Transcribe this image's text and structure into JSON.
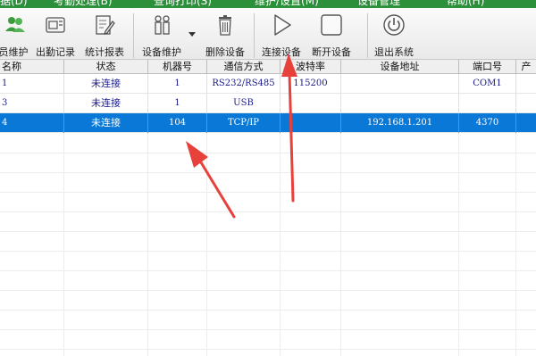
{
  "menubar": {
    "items": [
      "据(D)",
      "考勤处理(B)",
      "查询打印(S)",
      "维护/设置(M)",
      "设备管理",
      "帮助(H)"
    ]
  },
  "toolbar": {
    "buttons": [
      {
        "label": "员维护",
        "icon": "users-icon"
      },
      {
        "label": "出勤记录",
        "icon": "attendance-record-icon"
      },
      {
        "label": "统计报表",
        "icon": "report-edit-icon"
      },
      {
        "label": "设备维护",
        "icon": "device-maintenance-icon"
      },
      {
        "label": "删除设备",
        "icon": "trash-icon"
      },
      {
        "label": "连接设备",
        "icon": "play-icon"
      },
      {
        "label": "断开设备",
        "icon": "stop-icon"
      },
      {
        "label": "退出系统",
        "icon": "power-icon"
      }
    ]
  },
  "table": {
    "columns": [
      "名称",
      "状态",
      "机器号",
      "通信方式",
      "波特率",
      "设备地址",
      "端口号",
      "产"
    ],
    "rows": [
      {
        "name": "1",
        "status": "未连接",
        "machine_no": "1",
        "comm": "RS232/RS485",
        "baud": "115200",
        "address": "",
        "port": "COM1",
        "selected": false
      },
      {
        "name": "3",
        "status": "未连接",
        "machine_no": "1",
        "comm": "USB",
        "baud": "",
        "address": "",
        "port": "",
        "selected": false
      },
      {
        "name": "4",
        "status": "未连接",
        "machine_no": "104",
        "comm": "TCP/IP",
        "baud": "",
        "address": "192.168.1.201",
        "port": "4370",
        "selected": true
      }
    ]
  },
  "colors": {
    "menubar": "#2c8f3a",
    "selection": "#0a78d7",
    "annotation_arrow": "#e8413b",
    "cell_text": "#1a1a8c"
  }
}
